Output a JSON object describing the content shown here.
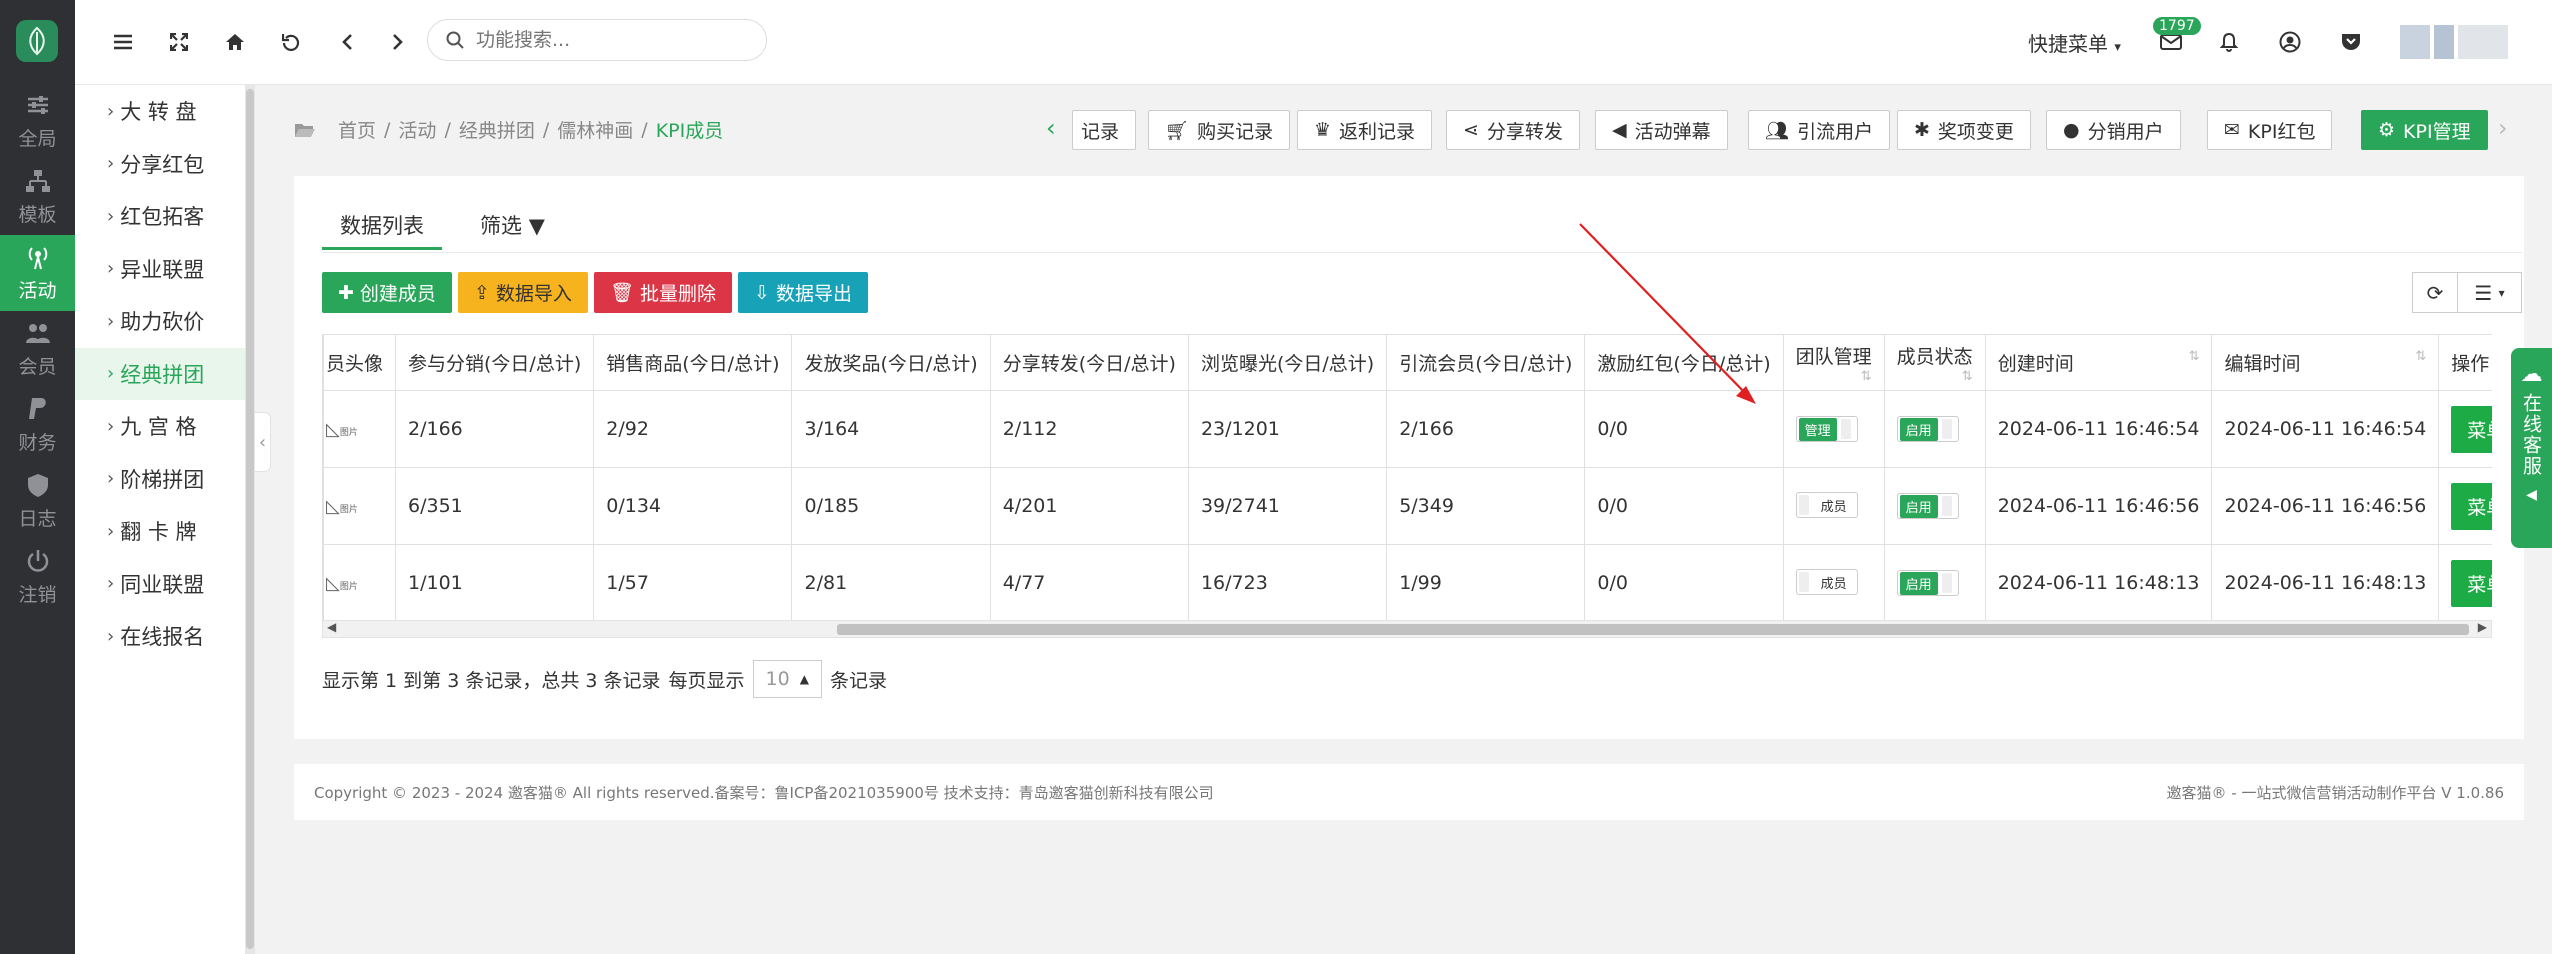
{
  "rail": {
    "items": [
      {
        "label": "全局",
        "icon": "sliders-icon"
      },
      {
        "label": "模板",
        "icon": "sitemap-icon"
      },
      {
        "label": "活动",
        "icon": "broadcast-icon",
        "active": true
      },
      {
        "label": "会员",
        "icon": "users-icon"
      },
      {
        "label": "财务",
        "icon": "paypal-icon"
      },
      {
        "label": "日志",
        "icon": "shield-icon"
      },
      {
        "label": "注销",
        "icon": "power-icon"
      }
    ]
  },
  "sidebar": {
    "items": [
      {
        "label": "大 转 盘"
      },
      {
        "label": "分享红包"
      },
      {
        "label": "红包拓客"
      },
      {
        "label": "异业联盟"
      },
      {
        "label": "助力砍价"
      },
      {
        "label": "经典拼团",
        "active": true
      },
      {
        "label": "九 宫 格"
      },
      {
        "label": "阶梯拼团"
      },
      {
        "label": "翻 卡 牌"
      },
      {
        "label": "同业联盟"
      },
      {
        "label": "在线报名"
      }
    ]
  },
  "topbar": {
    "search_placeholder": "功能搜索...",
    "quick_menu": "快捷菜单",
    "mail_badge": "1797"
  },
  "breadcrumb": {
    "items": [
      "首页",
      "活动",
      "经典拼团",
      "儒林神画"
    ],
    "current": "KPI成员"
  },
  "quick_tabs": [
    {
      "label": "记录",
      "icon": ""
    },
    {
      "label": "购买记录",
      "icon": "cart-icon"
    },
    {
      "label": "返利记录",
      "icon": "trophy-icon"
    },
    {
      "label": "分享转发",
      "icon": "share-icon"
    },
    {
      "label": "活动弹幕",
      "icon": "bullhorn-icon"
    },
    {
      "label": "引流用户",
      "icon": "users-icon"
    },
    {
      "label": "奖项变更",
      "icon": "bug-icon"
    },
    {
      "label": "分销用户",
      "icon": "user-icon"
    },
    {
      "label": "KPI红包",
      "icon": "envelope-icon"
    },
    {
      "label": "KPI管理",
      "icon": "gear-icon",
      "active": true
    }
  ],
  "panel": {
    "tabs": [
      {
        "label": "数据列表",
        "active": true
      },
      {
        "label": "筛选"
      }
    ],
    "actions": {
      "create": "创建成员",
      "import": "数据导入",
      "delete": "批量删除",
      "export": "数据导出"
    }
  },
  "table": {
    "columns": [
      "员头像",
      "参与分销(今日/总计)",
      "销售商品(今日/总计)",
      "发放奖品(今日/总计)",
      "分享转发(今日/总计)",
      "浏览曝光(今日/总计)",
      "引流会员(今日/总计)",
      "激励红包(今日/总计)",
      "团队管理",
      "成员状态",
      "创建时间",
      "编辑时间",
      "操作"
    ],
    "rows": [
      {
        "avatar": "图片",
        "c1": "2/166",
        "c2": "2/92",
        "c3": "3/164",
        "c4": "2/112",
        "c5": "23/1201",
        "c6": "2/166",
        "c7": "0/0",
        "team": "管理",
        "team_on": true,
        "status": "启用",
        "created": "2024-06-11 16:46:54",
        "edited": "2024-06-11 16:46:54",
        "op": "菜单"
      },
      {
        "avatar": "图片",
        "c1": "6/351",
        "c2": "0/134",
        "c3": "0/185",
        "c4": "4/201",
        "c5": "39/2741",
        "c6": "5/349",
        "c7": "0/0",
        "team": "成员",
        "team_on": false,
        "status": "启用",
        "created": "2024-06-11 16:46:56",
        "edited": "2024-06-11 16:46:56",
        "op": "菜单"
      },
      {
        "avatar": "图片",
        "c1": "1/101",
        "c2": "1/57",
        "c3": "2/81",
        "c4": "4/77",
        "c5": "16/723",
        "c6": "1/99",
        "c7": "0/0",
        "team": "成员",
        "team_on": false,
        "status": "启用",
        "created": "2024-06-11 16:48:13",
        "edited": "2024-06-11 16:48:13",
        "op": "菜单"
      }
    ]
  },
  "pager": {
    "summary": "显示第 1 到第 3 条记录，总共 3 条记录",
    "per_page_prefix": "每页显示",
    "per_page": "10",
    "per_page_suffix": "条记录"
  },
  "footer": {
    "left": "Copyright © 2023 - 2024 邀客猫® All rights reserved.备案号：鲁ICP备2021035900号 技术支持：青岛邀客猫创新科技有限公司",
    "right": "邀客猫® - 一站式微信营销活动制作平台 V 1.0.86"
  },
  "service": {
    "label": "在线客服"
  },
  "colors": {
    "accent": "#2aa65a",
    "warning": "#f7b31d",
    "danger": "#dc3545",
    "info": "#17a2b8",
    "rail": "#2f3033"
  }
}
